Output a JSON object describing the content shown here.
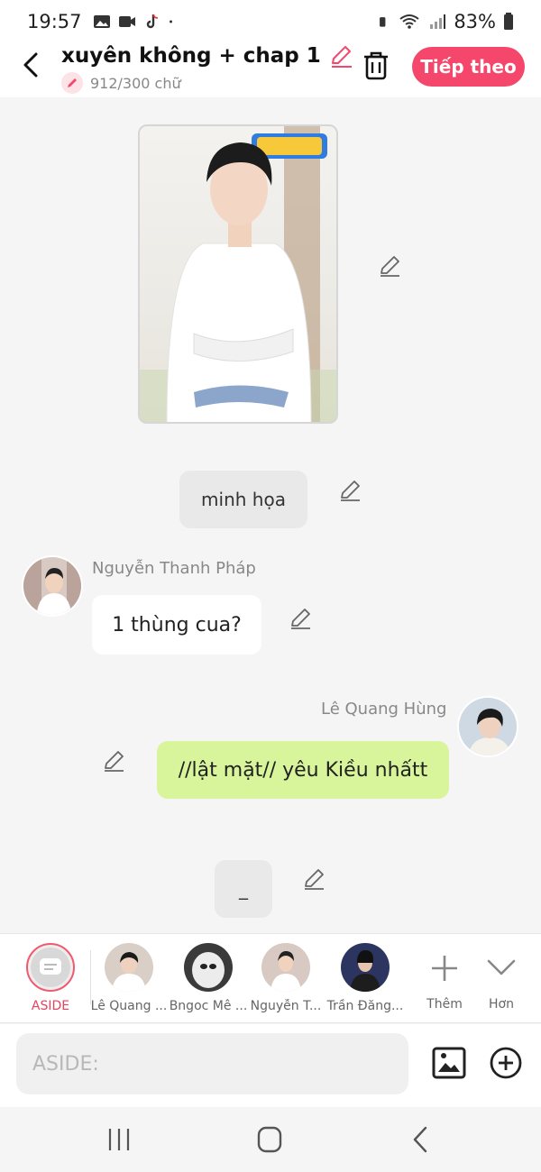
{
  "status": {
    "time": "19:57",
    "battery": "83%"
  },
  "header": {
    "title": "xuyên không + chap 1",
    "word_count": "912/300 chữ",
    "next_label": "Tiếp theo"
  },
  "messages": {
    "aside_text": "minh họa",
    "left_name": "Nguyễn Thanh Pháp",
    "left_text": "1 thùng cua?",
    "right_name": "Lê Quang Hùng",
    "right_text": "//lật mặt// yêu Kiều nhấtt",
    "dash_text": "_"
  },
  "characters": [
    {
      "label": "ASIDE"
    },
    {
      "label": "Lê Quang ..."
    },
    {
      "label": "Bngoc Mê ..."
    },
    {
      "label": "Nguyễn T..."
    },
    {
      "label": "Trần Đăng..."
    }
  ],
  "add_label": "Thêm",
  "more_label": "Hơn",
  "input": {
    "placeholder": "ASIDE:"
  },
  "colors": {
    "accent": "#f5466b",
    "right_bubble": "#d9f59c",
    "aside_ring": "#f05a6e"
  }
}
